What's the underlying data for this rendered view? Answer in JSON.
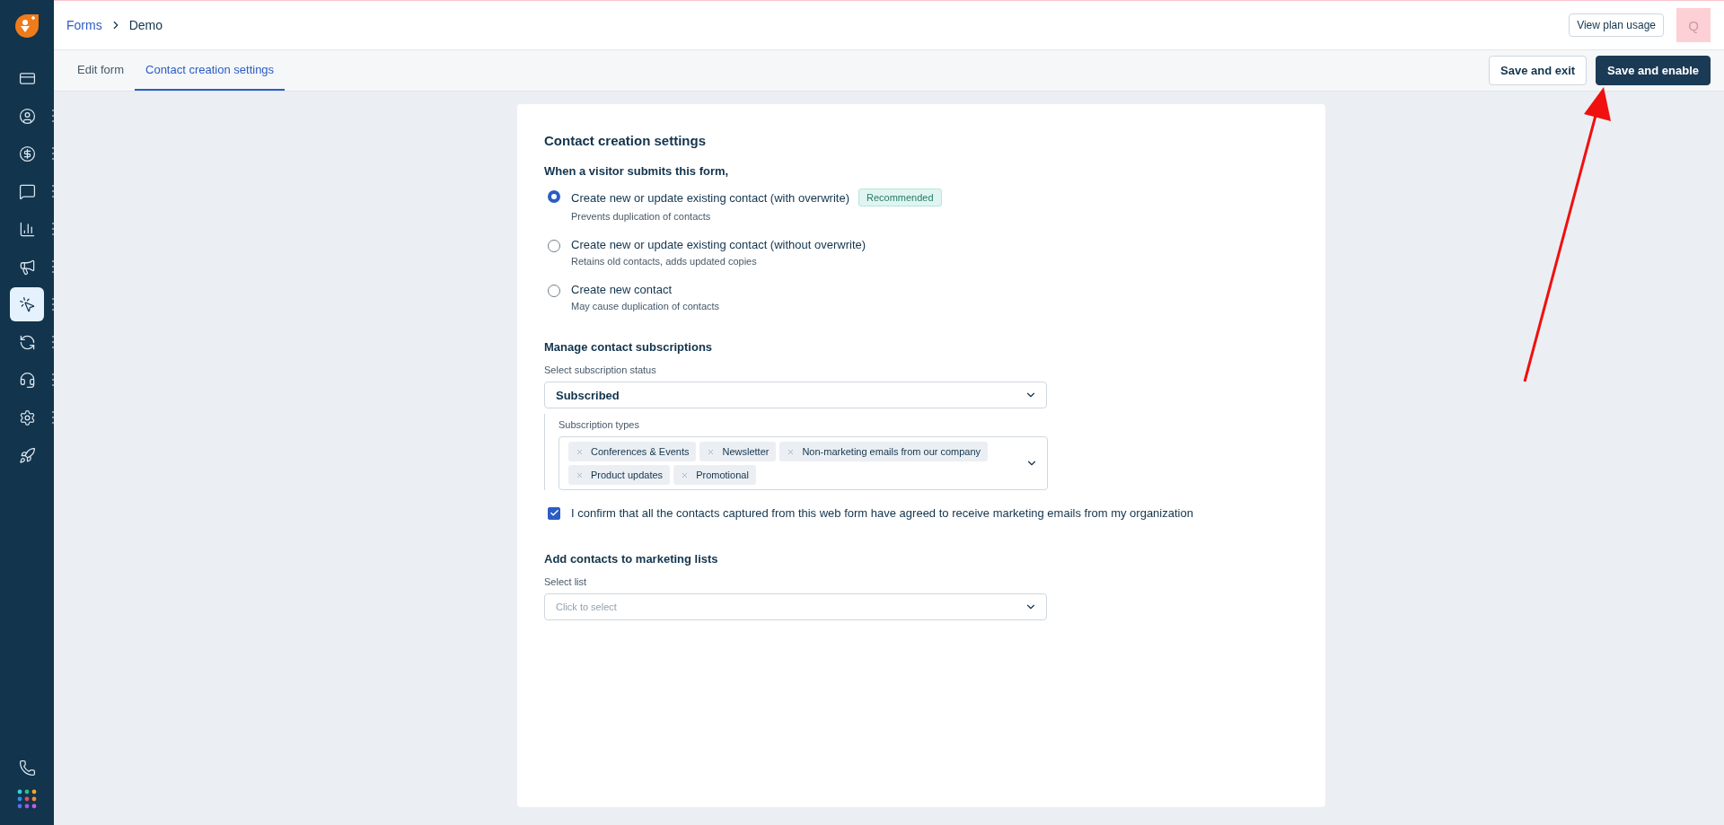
{
  "breadcrumb": [
    {
      "label": "Forms",
      "kind": "link"
    },
    {
      "label": "Demo",
      "kind": "current"
    }
  ],
  "header": {
    "plan_button": "View plan usage",
    "avatar": "Q"
  },
  "sidebar": {
    "items": [
      {
        "selected": false,
        "menu": false
      },
      {
        "selected": false,
        "menu": true
      },
      {
        "selected": false,
        "menu": true
      },
      {
        "selected": false,
        "menu": true
      },
      {
        "selected": false,
        "menu": true
      },
      {
        "selected": false,
        "menu": true
      },
      {
        "selected": true,
        "menu": true
      },
      {
        "selected": false,
        "menu": true
      },
      {
        "selected": false,
        "menu": true
      },
      {
        "selected": false,
        "menu": true
      },
      {
        "selected": false,
        "menu": false
      }
    ]
  },
  "tabs": [
    {
      "label": "Edit form",
      "selected": false
    },
    {
      "label": "Contact creation settings",
      "selected": true
    }
  ],
  "actions": [
    {
      "label": "Save and exit",
      "kind": "secondary"
    },
    {
      "label": "Save and enable",
      "kind": "primary"
    }
  ],
  "card": {
    "title": "Contact creation settings",
    "question": "When a visitor submits this form,",
    "options": [
      {
        "label": "Create new or update existing contact (with overwrite)",
        "hint": "Prevents duplication of contacts",
        "badge": "Recommended",
        "selected": true
      },
      {
        "label": "Create new or update existing contact (without overwrite)",
        "hint": "Retains old contacts, adds updated copies",
        "selected": false
      },
      {
        "label": "Create new contact",
        "hint": "May cause duplication of contacts",
        "selected": false
      }
    ],
    "subscriptions": {
      "title": "Manage contact subscriptions",
      "status_label": "Select subscription status",
      "status_value": "Subscribed",
      "types_label": "Subscription types",
      "types": [
        "Conferences & Events",
        "Newsletter",
        "Non-marketing emails from our company",
        "Product updates",
        "Promotional"
      ],
      "consent": {
        "label": "I confirm that all the contacts captured from this web form have agreed to receive marketing emails from my organization",
        "checked": true
      }
    },
    "lists": {
      "title": "Add contacts to marketing lists",
      "label": "Select list",
      "placeholder": "Click to select"
    }
  }
}
